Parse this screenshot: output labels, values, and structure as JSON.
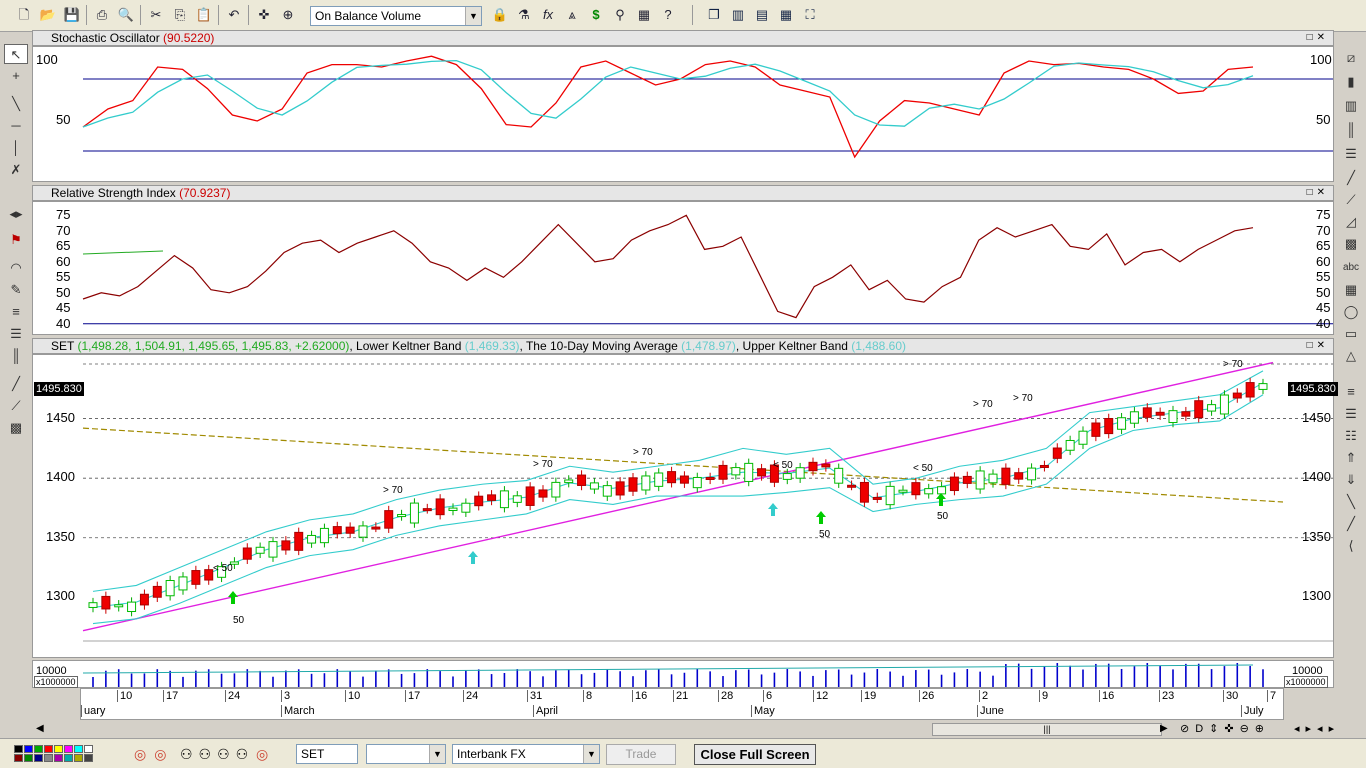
{
  "toolbar": {
    "indicator_select": "On Balance Volume"
  },
  "panels": {
    "stoch": {
      "label": "Stochastic Oscillator",
      "value": "(90.5220)",
      "ticks": [
        "100",
        "50"
      ],
      "ticks_right": [
        "100",
        "50"
      ]
    },
    "rsi": {
      "label": "Relative Strength Index",
      "value": "(70.9237)",
      "ticks": [
        "75",
        "70",
        "65",
        "60",
        "55",
        "50",
        "45",
        "40"
      ]
    },
    "price": {
      "label": "SET",
      "ohlc": "(1,498.28, 1,504.91, 1,495.65, 1,495.83, +2.62000)",
      "lower_label": "Lower Keltner Band",
      "lower_value": "(1,469.33)",
      "ma_label": "The 10-Day Moving Average",
      "ma_value": "(1,478.97)",
      "upper_label": "Upper Keltner Band",
      "upper_value": "(1,488.60)",
      "last_price": "1495.830",
      "ticks": [
        "1450",
        "1400",
        "1350",
        "1300"
      ]
    },
    "volume": {
      "tick": "10000",
      "multiplier": "x1000000"
    }
  },
  "annotations": {
    "gt70": "> 70",
    "lt50": "< 50",
    "fifty": "50"
  },
  "xaxis": {
    "days": [
      "10",
      "17",
      "24",
      "3",
      "10",
      "17",
      "24",
      "31",
      "8",
      "16",
      "21",
      "28",
      "6",
      "12",
      "19",
      "26",
      "2",
      "9",
      "16",
      "23",
      "30",
      "7"
    ],
    "months": [
      "uary",
      "March",
      "April",
      "May",
      "June",
      "July"
    ]
  },
  "status": {
    "symbol_input": "SET",
    "empty_combo": "",
    "market_combo": "Interbank FX",
    "trade_button": "Trade",
    "fullscreen_button": "Close Full Screen"
  },
  "chart_data": {
    "type": "line",
    "series": [
      {
        "name": "Stochastic Oscillator",
        "values": [
          40,
          55,
          62,
          90,
          88,
          72,
          50,
          45,
          55,
          85,
          92,
          92,
          90,
          95,
          99,
          92,
          72,
          42,
          40,
          60,
          90,
          95,
          85,
          75,
          80,
          92,
          95,
          90,
          75,
          70,
          65,
          15,
          45,
          62,
          60,
          55,
          50,
          85,
          95,
          92,
          93,
          90,
          88,
          80,
          68,
          70,
          88,
          90
        ]
      },
      {
        "name": "Relative Strength Index",
        "values": [
          48,
          50,
          49,
          52,
          57,
          62,
          58,
          51,
          50,
          52,
          57,
          63,
          66,
          67,
          63,
          66,
          68,
          70,
          66,
          60,
          58,
          54,
          58,
          55,
          60,
          66,
          72,
          66,
          60,
          61,
          67,
          70,
          72,
          75,
          64,
          65,
          68,
          56,
          44,
          42,
          52,
          55,
          59,
          51,
          54,
          48,
          47,
          52,
          55,
          67,
          71,
          68,
          70,
          72,
          65,
          64,
          69,
          59,
          63,
          64,
          60,
          64,
          67,
          70,
          71
        ]
      },
      {
        "name": "Upper Keltner Band",
        "values": [
          1305,
          1310,
          1325,
          1340,
          1355,
          1365,
          1370,
          1382,
          1390,
          1395,
          1398,
          1410,
          1405,
          1410,
          1415,
          1425,
          1420,
          1425,
          1395,
          1400,
          1410,
          1415,
          1425,
          1455,
          1460,
          1465,
          1470,
          1490
        ]
      },
      {
        "name": "Lower Keltner Band",
        "values": [
          1278,
          1282,
          1295,
          1310,
          1325,
          1335,
          1340,
          1352,
          1360,
          1365,
          1370,
          1382,
          1378,
          1385,
          1385,
          1385,
          1388,
          1392,
          1372,
          1378,
          1382,
          1385,
          1395,
          1425,
          1440,
          1445,
          1448,
          1470
        ]
      }
    ],
    "ylim_price": [
      1260,
      1500
    ],
    "ylim_stoch": [
      0,
      100
    ],
    "ylim_rsi": [
      38,
      78
    ]
  }
}
